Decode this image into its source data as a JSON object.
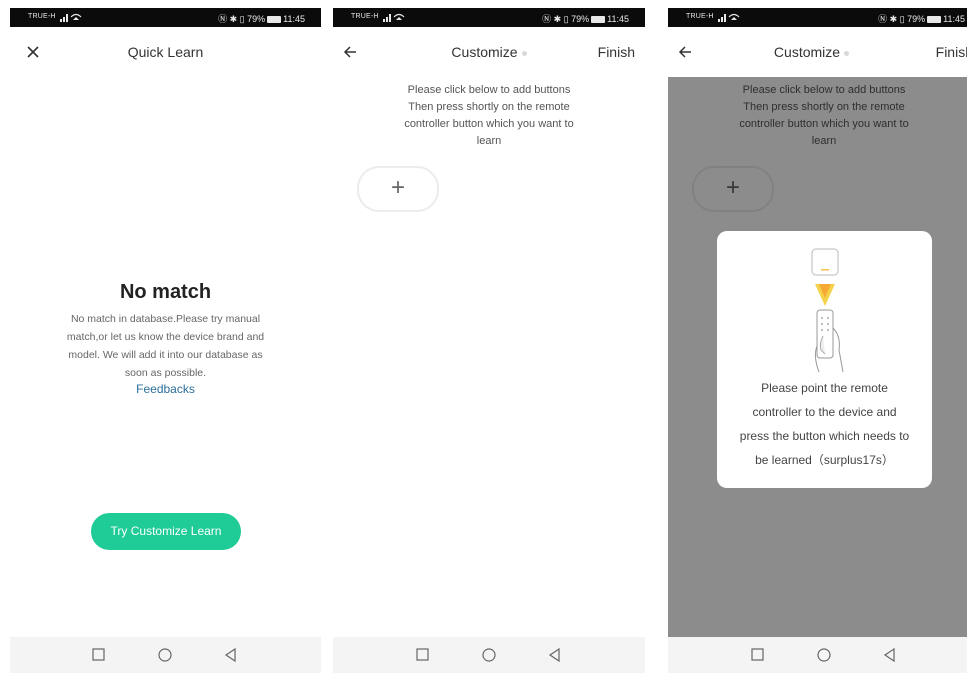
{
  "status_bar": {
    "carrier": "TRUE-H",
    "right_text": "Ⓝ ✱ ▯ 79%",
    "time": "11:45"
  },
  "panel1": {
    "title": "Quick Learn",
    "heading": "No match",
    "description": "No match in database.Please try manual match,or let us know the device brand and model. We will add it into our database as soon as possible.",
    "feedback_link": "Feedbacks",
    "primary_button": "Try Customize Learn"
  },
  "panel2": {
    "title": "Customize",
    "finish": "Finish",
    "instructions": [
      "Please click below to add buttons",
      "Then press shortly on the remote",
      "controller button which you want to",
      "learn"
    ],
    "add_button": "+"
  },
  "panel3": {
    "title": "Customize",
    "finish": "Finish",
    "instructions": [
      "Please click below to add buttons",
      "Then press shortly on the remote",
      "controller button which you want to",
      "learn"
    ],
    "add_button": "+",
    "dialog_text": [
      "Please point the remote",
      "controller to the device and",
      "press the button which needs to",
      "be learned（surplus17s）"
    ]
  },
  "icons": {
    "close": "close-icon",
    "back": "arrow-left-icon",
    "recent": "square-icon",
    "home": "circle-icon",
    "nav_back": "triangle-icon",
    "illustration": "remote-pointing-icon"
  },
  "colors": {
    "accent": "#1fcb96",
    "link": "#2b6f99",
    "status_bar": "#0b0b0b",
    "overlay": "rgba(0,0,0,0.45)"
  }
}
